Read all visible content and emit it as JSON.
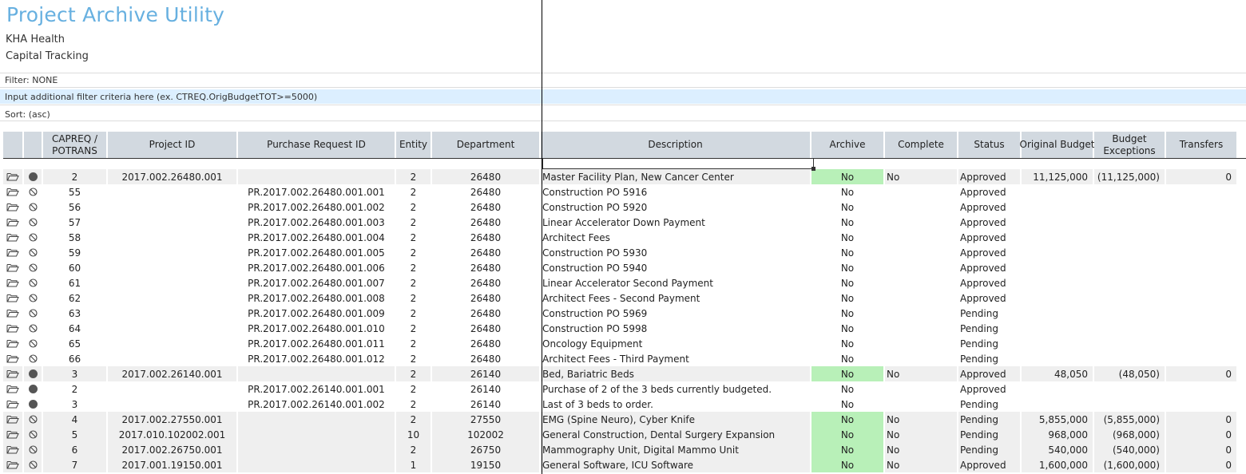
{
  "app": {
    "title": "Project Archive Utility",
    "org": "KHA Health",
    "module": "Capital Tracking"
  },
  "filter": {
    "label": "Filter: NONE",
    "placeholder": "Input additional filter criteria here (ex. CTREQ.OrigBudgetTOT>=5000)"
  },
  "sort": {
    "label": "Sort:  (asc)"
  },
  "columns": {
    "capreq": [
      "CAPREQ /",
      "POTRANS"
    ],
    "project_id": "Project ID",
    "purchase_request_id": "Purchase Request ID",
    "entity": "Entity",
    "department": "Department",
    "description": "Description",
    "archive": "Archive",
    "complete": "Complete",
    "status": "Status",
    "original_budget": "Original Budget",
    "budget_exceptions": [
      "Budget",
      "Exceptions"
    ],
    "transfers": "Transfers"
  },
  "rows": [
    {
      "parent": true,
      "marker": "dot",
      "capreq": "2",
      "project_id": "2017.002.26480.001",
      "pr_id": "",
      "entity": "2",
      "dept": "26480",
      "desc": "Master Facility Plan, New Cancer Center",
      "archive": "No",
      "complete": "No",
      "status": "Approved",
      "budget": "11,125,000",
      "exceptions": "(11,125,000)",
      "transfers": "0"
    },
    {
      "parent": false,
      "marker": "ban",
      "capreq": "55",
      "project_id": "",
      "pr_id": "PR.2017.002.26480.001.001",
      "entity": "2",
      "dept": "26480",
      "desc": "Construction PO 5916",
      "archive": "No",
      "complete": "",
      "status": "Approved",
      "budget": "",
      "exceptions": "",
      "transfers": ""
    },
    {
      "parent": false,
      "marker": "ban",
      "capreq": "56",
      "project_id": "",
      "pr_id": "PR.2017.002.26480.001.002",
      "entity": "2",
      "dept": "26480",
      "desc": "Construction PO 5920",
      "archive": "No",
      "complete": "",
      "status": "Approved",
      "budget": "",
      "exceptions": "",
      "transfers": ""
    },
    {
      "parent": false,
      "marker": "ban",
      "capreq": "57",
      "project_id": "",
      "pr_id": "PR.2017.002.26480.001.003",
      "entity": "2",
      "dept": "26480",
      "desc": "Linear Accelerator Down Payment",
      "archive": "No",
      "complete": "",
      "status": "Approved",
      "budget": "",
      "exceptions": "",
      "transfers": ""
    },
    {
      "parent": false,
      "marker": "ban",
      "capreq": "58",
      "project_id": "",
      "pr_id": "PR.2017.002.26480.001.004",
      "entity": "2",
      "dept": "26480",
      "desc": "Architect Fees",
      "archive": "No",
      "complete": "",
      "status": "Approved",
      "budget": "",
      "exceptions": "",
      "transfers": ""
    },
    {
      "parent": false,
      "marker": "ban",
      "capreq": "59",
      "project_id": "",
      "pr_id": "PR.2017.002.26480.001.005",
      "entity": "2",
      "dept": "26480",
      "desc": "Construction PO 5930",
      "archive": "No",
      "complete": "",
      "status": "Approved",
      "budget": "",
      "exceptions": "",
      "transfers": ""
    },
    {
      "parent": false,
      "marker": "ban",
      "capreq": "60",
      "project_id": "",
      "pr_id": "PR.2017.002.26480.001.006",
      "entity": "2",
      "dept": "26480",
      "desc": "Construction PO 5940",
      "archive": "No",
      "complete": "",
      "status": "Approved",
      "budget": "",
      "exceptions": "",
      "transfers": ""
    },
    {
      "parent": false,
      "marker": "ban",
      "capreq": "61",
      "project_id": "",
      "pr_id": "PR.2017.002.26480.001.007",
      "entity": "2",
      "dept": "26480",
      "desc": "Linear Accelerator Second Payment",
      "archive": "No",
      "complete": "",
      "status": "Approved",
      "budget": "",
      "exceptions": "",
      "transfers": ""
    },
    {
      "parent": false,
      "marker": "ban",
      "capreq": "62",
      "project_id": "",
      "pr_id": "PR.2017.002.26480.001.008",
      "entity": "2",
      "dept": "26480",
      "desc": "Architect Fees - Second Payment",
      "archive": "No",
      "complete": "",
      "status": "Approved",
      "budget": "",
      "exceptions": "",
      "transfers": ""
    },
    {
      "parent": false,
      "marker": "ban",
      "capreq": "63",
      "project_id": "",
      "pr_id": "PR.2017.002.26480.001.009",
      "entity": "2",
      "dept": "26480",
      "desc": "Construction PO 5969",
      "archive": "No",
      "complete": "",
      "status": "Pending",
      "budget": "",
      "exceptions": "",
      "transfers": ""
    },
    {
      "parent": false,
      "marker": "ban",
      "capreq": "64",
      "project_id": "",
      "pr_id": "PR.2017.002.26480.001.010",
      "entity": "2",
      "dept": "26480",
      "desc": "Construction PO 5998",
      "archive": "No",
      "complete": "",
      "status": "Pending",
      "budget": "",
      "exceptions": "",
      "transfers": ""
    },
    {
      "parent": false,
      "marker": "ban",
      "capreq": "65",
      "project_id": "",
      "pr_id": "PR.2017.002.26480.001.011",
      "entity": "2",
      "dept": "26480",
      "desc": "Oncology Equipment",
      "archive": "No",
      "complete": "",
      "status": "Pending",
      "budget": "",
      "exceptions": "",
      "transfers": ""
    },
    {
      "parent": false,
      "marker": "ban",
      "capreq": "66",
      "project_id": "",
      "pr_id": "PR.2017.002.26480.001.012",
      "entity": "2",
      "dept": "26480",
      "desc": "Architect Fees - Third Payment",
      "archive": "No",
      "complete": "",
      "status": "Pending",
      "budget": "",
      "exceptions": "",
      "transfers": ""
    },
    {
      "parent": true,
      "marker": "dot",
      "capreq": "3",
      "project_id": "2017.002.26140.001",
      "pr_id": "",
      "entity": "2",
      "dept": "26140",
      "desc": "Bed, Bariatric Beds",
      "archive": "No",
      "complete": "No",
      "status": "Approved",
      "budget": "48,050",
      "exceptions": "(48,050)",
      "transfers": "0"
    },
    {
      "parent": false,
      "marker": "dot",
      "capreq": "2",
      "project_id": "",
      "pr_id": "PR.2017.002.26140.001.001",
      "entity": "2",
      "dept": "26140",
      "desc": "Purchase of 2 of the 3 beds currently budgeted.",
      "archive": "No",
      "complete": "",
      "status": "Approved",
      "budget": "",
      "exceptions": "",
      "transfers": ""
    },
    {
      "parent": false,
      "marker": "dot",
      "capreq": "3",
      "project_id": "",
      "pr_id": "PR.2017.002.26140.001.002",
      "entity": "2",
      "dept": "26140",
      "desc": "Last of 3 beds to order.",
      "archive": "No",
      "complete": "",
      "status": "Pending",
      "budget": "",
      "exceptions": "",
      "transfers": ""
    },
    {
      "parent": true,
      "marker": "ban",
      "capreq": "4",
      "project_id": "2017.002.27550.001",
      "pr_id": "",
      "entity": "2",
      "dept": "27550",
      "desc": "EMG (Spine Neuro), Cyber Knife",
      "archive": "No",
      "complete": "No",
      "status": "Pending",
      "budget": "5,855,000",
      "exceptions": "(5,855,000)",
      "transfers": "0"
    },
    {
      "parent": true,
      "marker": "ban",
      "capreq": "5",
      "project_id": "2017.010.102002.001",
      "pr_id": "",
      "entity": "10",
      "dept": "102002",
      "desc": "General Construction, Dental Surgery Expansion",
      "archive": "No",
      "complete": "No",
      "status": "Pending",
      "budget": "968,000",
      "exceptions": "(968,000)",
      "transfers": "0"
    },
    {
      "parent": true,
      "marker": "ban",
      "capreq": "6",
      "project_id": "2017.002.26750.001",
      "pr_id": "",
      "entity": "2",
      "dept": "26750",
      "desc": "Mammography Unit, Digital Mammo Unit",
      "archive": "No",
      "complete": "No",
      "status": "Pending",
      "budget": "540,000",
      "exceptions": "(540,000)",
      "transfers": "0"
    },
    {
      "parent": true,
      "marker": "ban",
      "capreq": "7",
      "project_id": "2017.001.19150.001",
      "pr_id": "",
      "entity": "1",
      "dept": "19150",
      "desc": "General Software, ICU Software",
      "archive": "No",
      "complete": "No",
      "status": "Approved",
      "budget": "1,600,000",
      "exceptions": "(1,600,000)",
      "transfers": "0"
    }
  ]
}
